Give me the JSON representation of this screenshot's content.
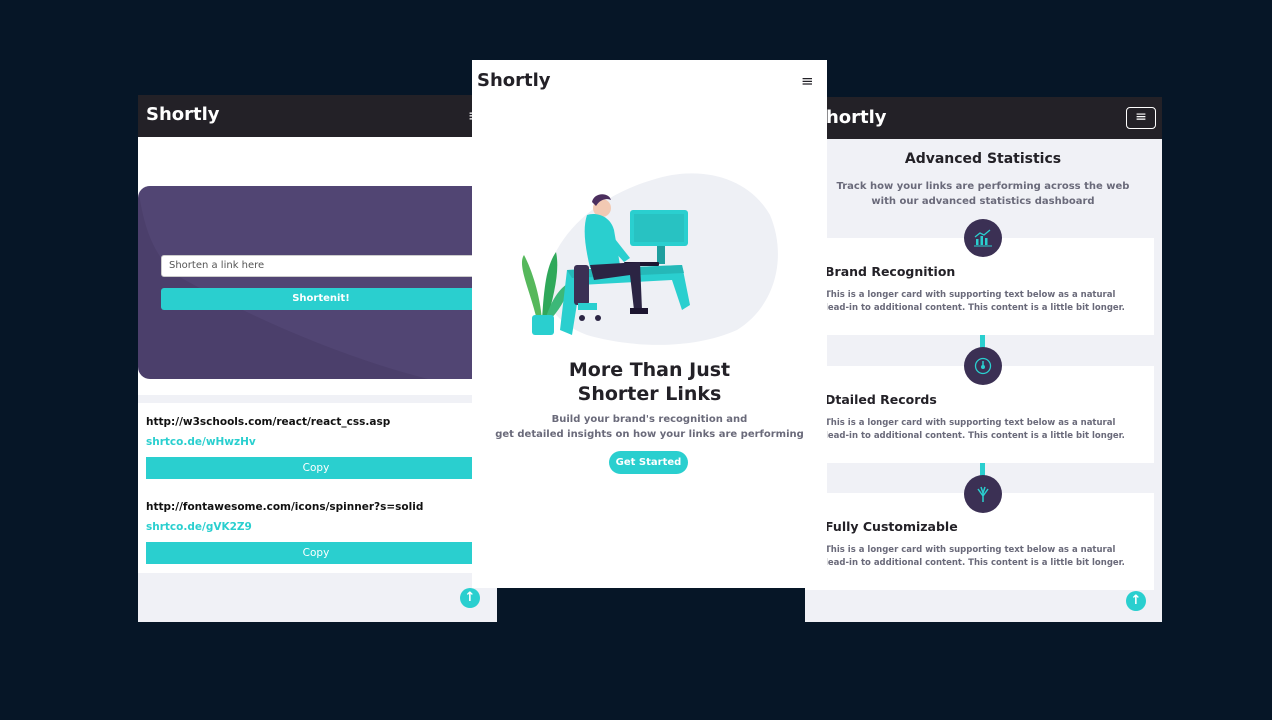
{
  "left": {
    "logo": "Shortly",
    "menu_icon": "≡",
    "input_placeholder": "Shorten a link here",
    "shorten_label": "Shortenit!",
    "results": [
      {
        "url": "http://w3schools.com/react/react_css.asp",
        "short": "shrtco.de/wHwzHv",
        "copy": "Copy"
      },
      {
        "url": "http://fontawesome.com/icons/spinner?s=solid",
        "short": "shrtco.de/gVK2Z9",
        "copy": "Copy"
      }
    ],
    "scroll_top_icon": "↑"
  },
  "middle": {
    "logo": "Shortly",
    "menu_icon": "≡",
    "heading_line1": "More Than Just",
    "heading_line2": "Shorter Links",
    "sub_line1": "Build your brand's recognition and",
    "sub_line2": "get detailed insights on how your links are performing",
    "cta": "Get Started"
  },
  "right": {
    "logo": "Shortly",
    "menu_icon": "≡",
    "title": "Advanced Statistics",
    "subtitle": "Track how your links are performing across the web with our advanced statistics dashboard",
    "cards": [
      {
        "title": "Brand Recognition",
        "desc": "This is a longer card with supporting text below as a natural lead-in to additional content. This content is a little bit longer.",
        "icon": "chart-icon"
      },
      {
        "title": "Dtailed Records",
        "desc": "This is a longer card with supporting text below as a natural lead-in to additional content. This content is a little bit longer.",
        "icon": "gauge-icon"
      },
      {
        "title": "Fully Customizable",
        "desc": "This is a longer card with supporting text below as a natural lead-in to additional content. This content is a little bit longer.",
        "icon": "brush-icon"
      }
    ],
    "scroll_top_icon": "↑"
  },
  "colors": {
    "background": "#061627",
    "accent": "#2acfcf",
    "dark": "#232127",
    "violet": "#3b3054"
  }
}
